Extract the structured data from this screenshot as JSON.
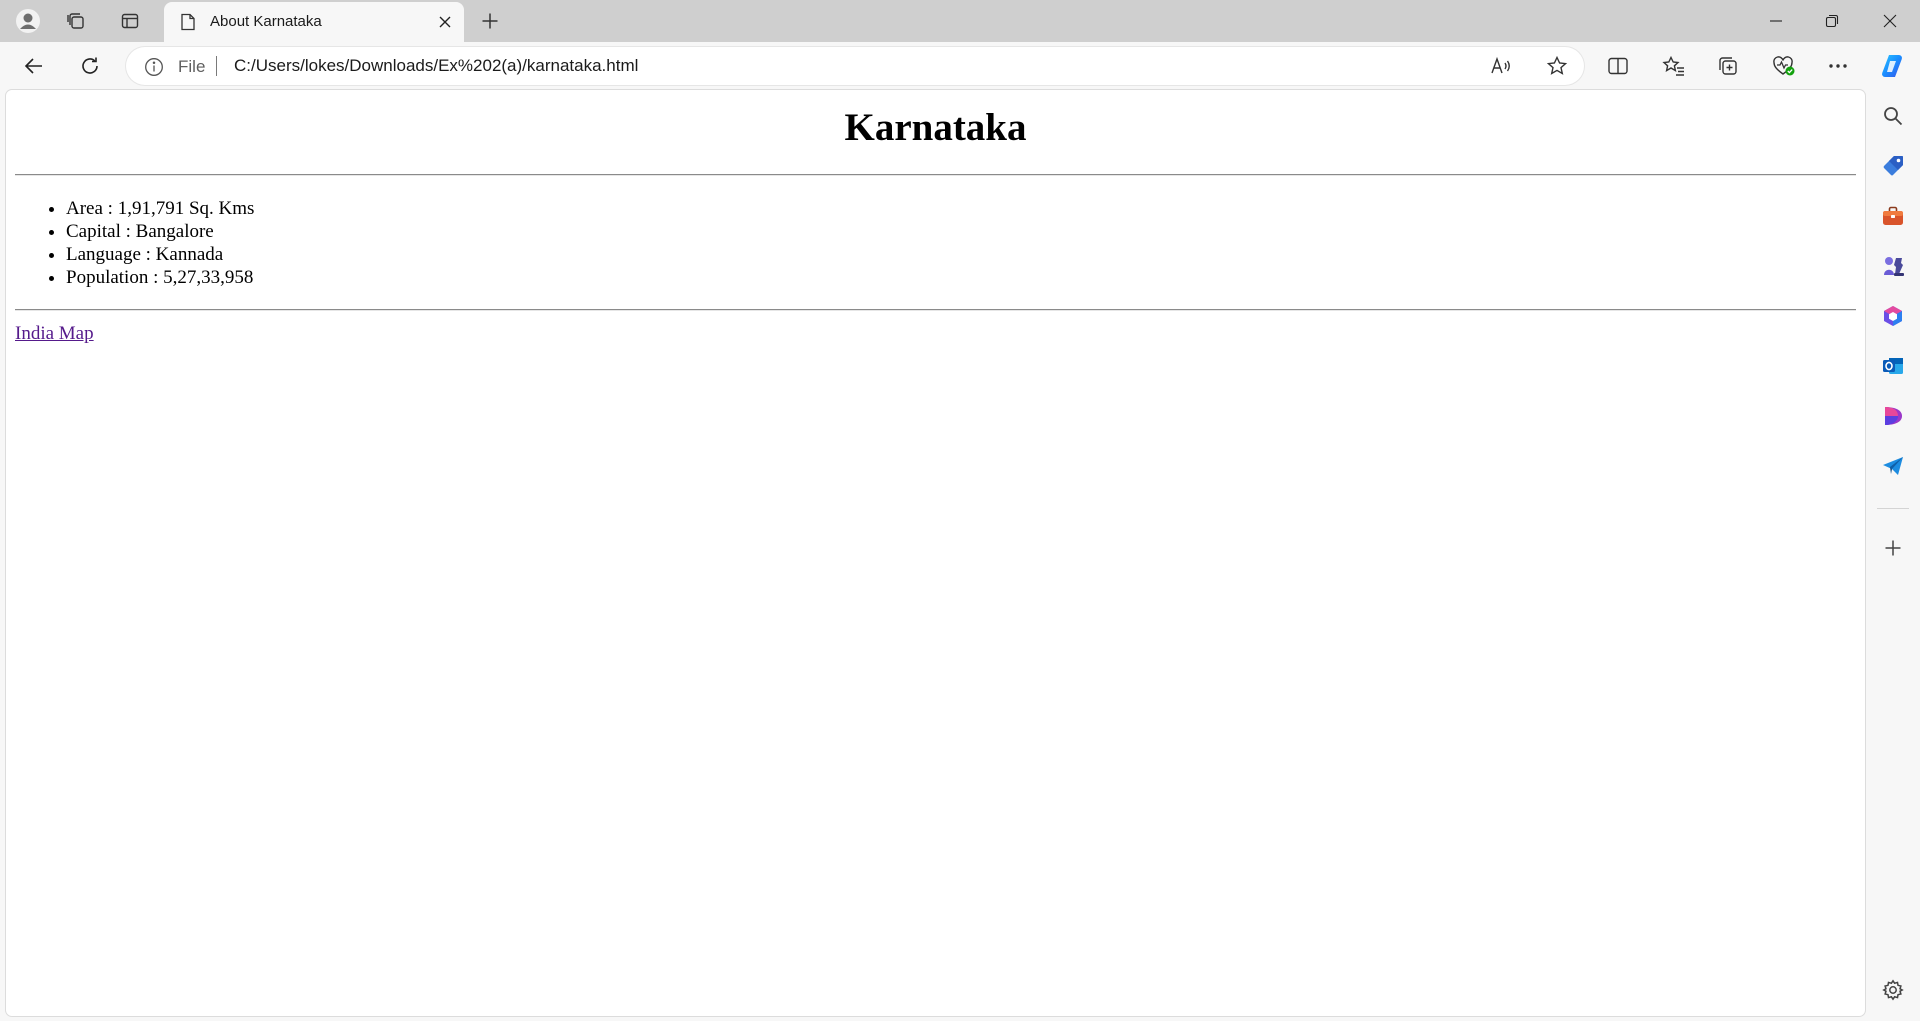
{
  "browser": {
    "tab": {
      "title": "About Karnataka"
    },
    "address_bar": {
      "scheme_label": "File",
      "url": "C:/Users/lokes/Downloads/Ex%202(a)/karnataka.html"
    }
  },
  "page": {
    "heading": "Karnataka",
    "facts": [
      "Area : 1,91,791 Sq. Kms",
      "Capital : Bangalore",
      "Language : Kannada",
      "Population : 5,27,33,958"
    ],
    "link_text": "India Map"
  },
  "icons": {
    "tabstrip": [
      "profile-icon",
      "workspaces-icon",
      "vertical-tabs-icon",
      "page-icon",
      "close-icon",
      "plus-icon",
      "minimize-icon",
      "restore-icon",
      "close-window-icon"
    ],
    "toolbar": [
      "back-icon",
      "refresh-icon",
      "info-icon",
      "read-aloud-icon",
      "favorite-star-icon",
      "split-screen-icon",
      "favorites-icon",
      "collections-icon",
      "browser-essentials-icon",
      "more-icon",
      "copilot-icon"
    ],
    "sidebar": [
      "search-icon",
      "shopping-tag-icon",
      "tools-briefcase-icon",
      "games-icon",
      "microsoft365-icon",
      "outlook-icon",
      "designer-icon",
      "send-icon",
      "add-icon",
      "settings-gear-icon"
    ]
  },
  "colors": {
    "visited_link": "#551a8b",
    "copilot_blue": "#1a8cff",
    "essentials_green": "#13a10e"
  }
}
